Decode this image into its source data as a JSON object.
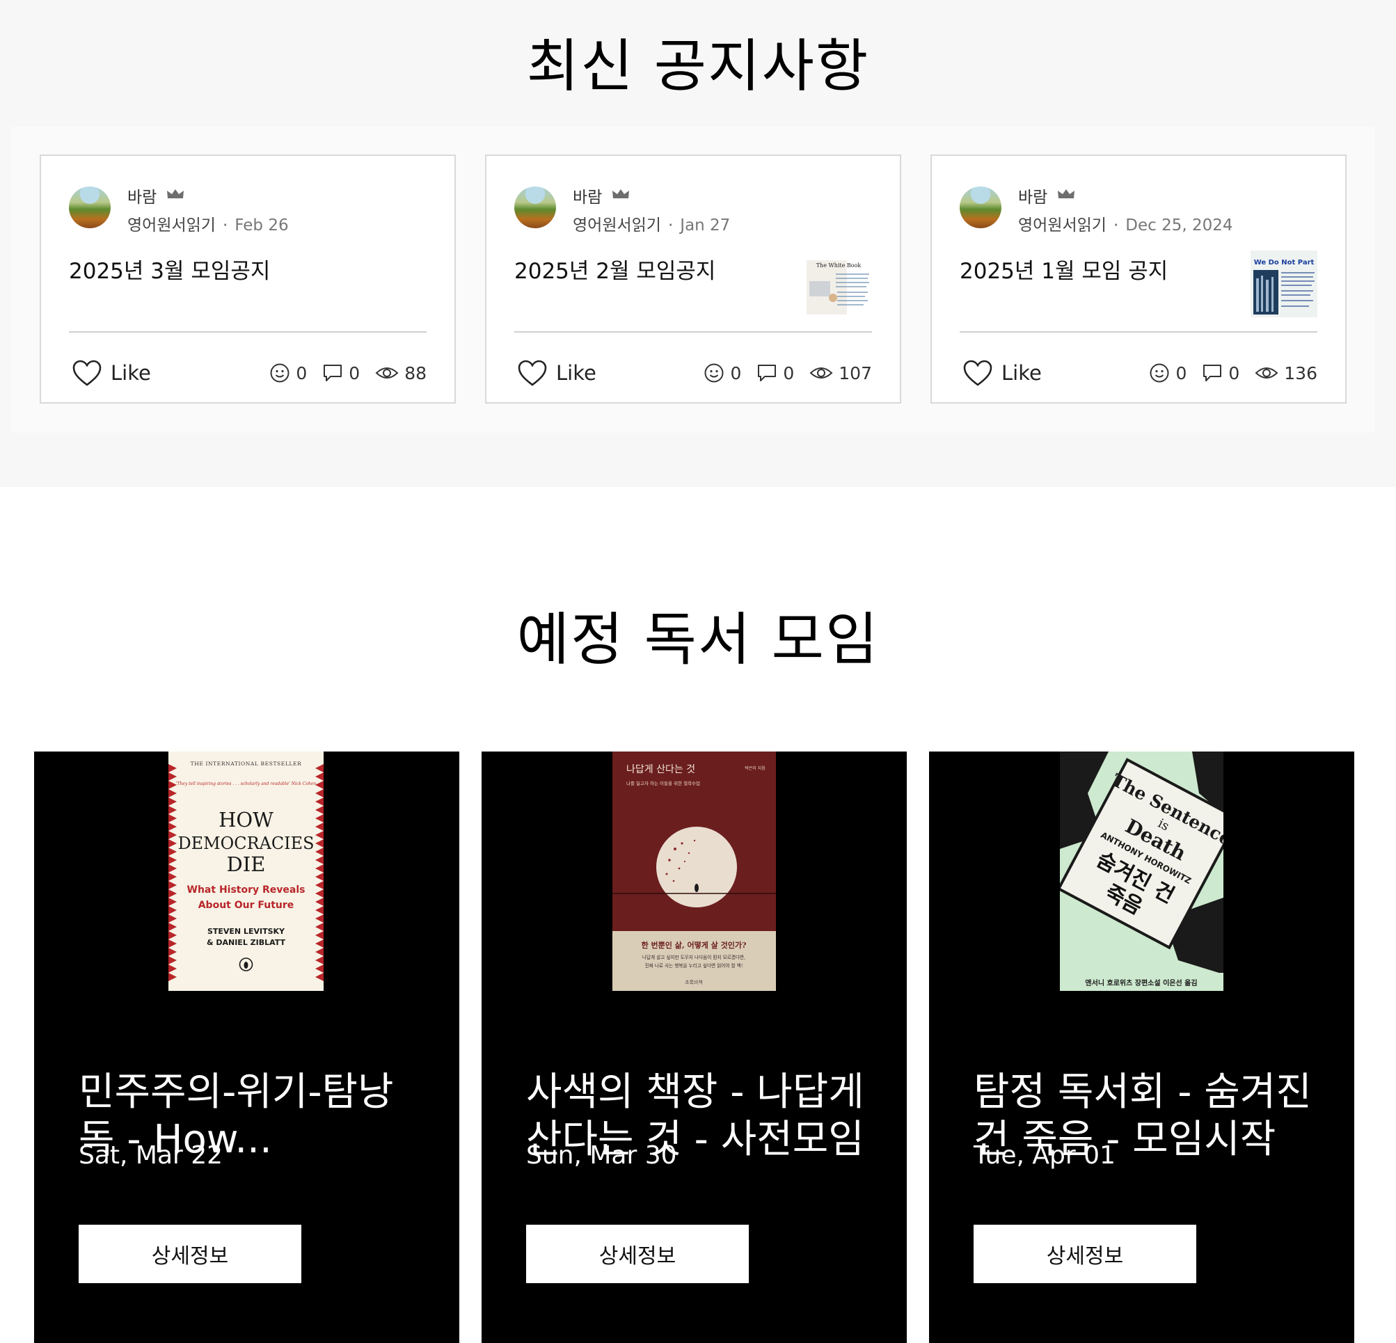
{
  "notices": {
    "title": "최신 공지사항",
    "posts": [
      {
        "author": "바람",
        "category": "영어원서읽기",
        "date": "Feb 26",
        "title": "2025년 3월 모임공지",
        "like_label": "Like",
        "reactions": "0",
        "comments": "0",
        "views": "88"
      },
      {
        "author": "바람",
        "category": "영어원서읽기",
        "date": "Jan 27",
        "title": "2025년 2월 모임공지",
        "like_label": "Like",
        "reactions": "0",
        "comments": "0",
        "views": "107",
        "thumb_title": "The White Book"
      },
      {
        "author": "바람",
        "category": "영어원서읽기",
        "date": "Dec 25, 2024",
        "title": "2025년 1월 모임 공지",
        "like_label": "Like",
        "reactions": "0",
        "comments": "0",
        "views": "136",
        "thumb_title": "We Do Not Part"
      }
    ]
  },
  "events": {
    "title": "예정 독서 모임",
    "button_label": "상세정보",
    "items": [
      {
        "title": "민주주의-위기-탐낭독 - How...",
        "date": "Sat, Mar 22",
        "cover": {
          "top": "THE INTERNATIONAL BESTSELLER",
          "quote": "'They tell inspiring stories . . . scholarly and readable' Nick Cohen",
          "line1": "HOW",
          "line2": "DEMOCRACIES",
          "line3": "DIE",
          "sub1": "What History Reveals",
          "sub2": "About Our Future",
          "author1": "STEVEN LEVITSKY",
          "author2": "& DANIEL ZIBLATT"
        }
      },
      {
        "title": "사색의 책장 - 나답게 산다는 것 - 사전모임",
        "date": "Sun, Mar 30",
        "cover": {
          "title": "나답게 산다는 것",
          "subtitle": "나를 잃고자 하는 이들을 위한 철학수업",
          "author": "박은미 지음",
          "tag": "한 번뿐인 삶, 어떻게 살 것인가?",
          "body1": "나답게 살고 싶지만 도무지 나다움이 뭔지 모르겠다면,",
          "body2": "진짜 나로 사는 행복을 누리고 싶다면 읽어야 할 책!",
          "publisher": "초록비책"
        }
      },
      {
        "title": "탐정 독서회 - 숨겨진 건 죽음 - 모임시작",
        "date": "Tue, Apr 01",
        "cover": {
          "en1": "The Sentence",
          "en2": "is",
          "en3": "Death",
          "author": "ANTHONY HOROWITZ",
          "ko1": "숨겨진 건",
          "ko2": "죽음",
          "bottom": "앤서니 호로위츠 장편소설 이은선 옮김"
        }
      }
    ]
  },
  "colors": {
    "section_bg": "#f7f7f7",
    "card_border": "#d9d9d9",
    "event_bg": "#000000",
    "cover_red": "#6b1e1e",
    "cover_green": "#cde9cf"
  }
}
